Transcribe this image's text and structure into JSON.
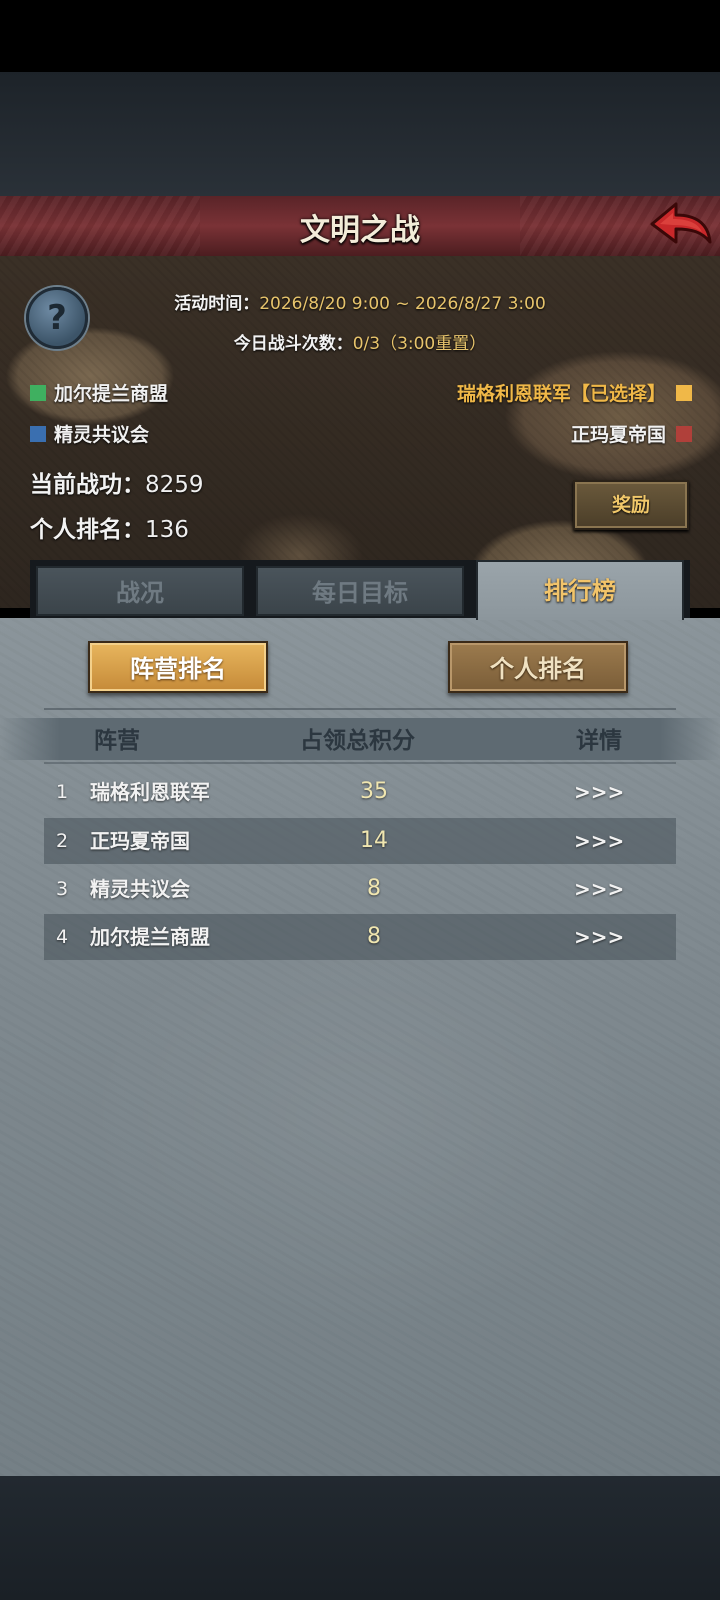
{
  "header": {
    "title": "文明之战"
  },
  "event": {
    "time_label": "活动时间：",
    "time_value": "2026/8/20 9:00 ~ 2026/8/27 3:00",
    "battles_label": "今日战斗次数：",
    "battles_value": "0/3（3:00重置）"
  },
  "factions": {
    "left": [
      {
        "name": "加尔提兰商盟",
        "color": "#3fb060"
      },
      {
        "name": "精灵共议会",
        "color": "#3a6fb0"
      }
    ],
    "right": [
      {
        "name": "瑞格利恩联军【已选择】",
        "color": "#f0b848"
      },
      {
        "name": "正玛夏帝国",
        "color": "#b0403a"
      }
    ]
  },
  "stats": {
    "merit_label": "当前战功：",
    "merit_value": "8259",
    "rank_label": "个人排名：",
    "rank_value": "136"
  },
  "reward_button": "奖励",
  "tabs": [
    "战况",
    "每日目标",
    "排行榜"
  ],
  "rank_buttons": {
    "camp": "阵营排名",
    "personal": "个人排名"
  },
  "table": {
    "headers": {
      "camp": "阵营",
      "score": "占领总积分",
      "detail": "详情"
    },
    "rows": [
      {
        "rank": "1",
        "name": "瑞格利恩联军",
        "score": "35",
        "detail": ">>>"
      },
      {
        "rank": "2",
        "name": "正玛夏帝国",
        "score": "14",
        "detail": ">>>"
      },
      {
        "rank": "3",
        "name": "精灵共议会",
        "score": "8",
        "detail": ">>>"
      },
      {
        "rank": "4",
        "name": "加尔提兰商盟",
        "score": "8",
        "detail": ">>>"
      }
    ]
  },
  "icons": {
    "help": "question-mark-icon",
    "back": "back-arrow-icon"
  },
  "colors": {
    "accent": "#e7c46c",
    "title_bar": "#7a3236",
    "active_tab_text": "#f2c46a"
  }
}
